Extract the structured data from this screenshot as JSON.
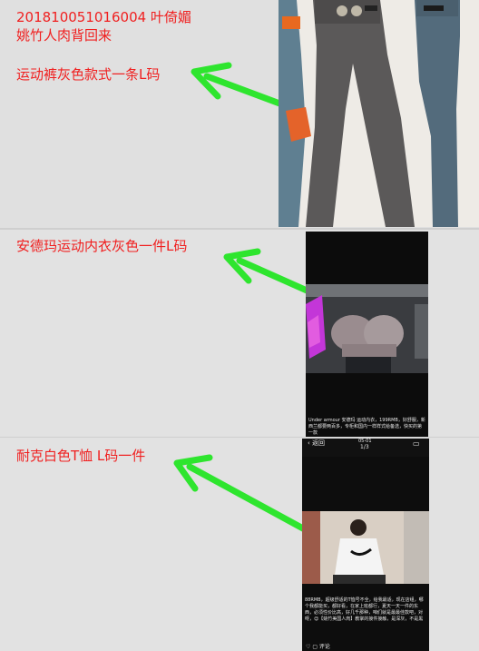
{
  "note1": {
    "line1": "201810051016004 叶倚媚",
    "line2": "姚竹人肉背回来",
    "item": "运动裤灰色款式一条L码"
  },
  "note2": {
    "item": "安德玛运动内衣灰色一件L码"
  },
  "note3": {
    "item": "耐克白色T恤 L码一件"
  },
  "phone2": {
    "caption": "Under armour 安德玛 运动内衣，199RMB，好舒服，新西兰都要两百多，专柜和国内一样样式给备选，快买的第一款"
  },
  "phone3": {
    "back_label": "返回",
    "date": "05-01",
    "page": "1/3",
    "caption": "88RMB，超级舒适的T恤号不全，给我最适，现在店组，哪个我都能买，都好看，在家上班都行，夏天一天一件的东西，必须性价比高，好几千那种，咱们就是最最佳款吧，对呀，😊【姚竹美国人肉】教掌的接件接触，是深灰，不是黑",
    "comment_label": "评论",
    "arrow_color": "#2ee52e",
    "text_color": "#f02020"
  }
}
